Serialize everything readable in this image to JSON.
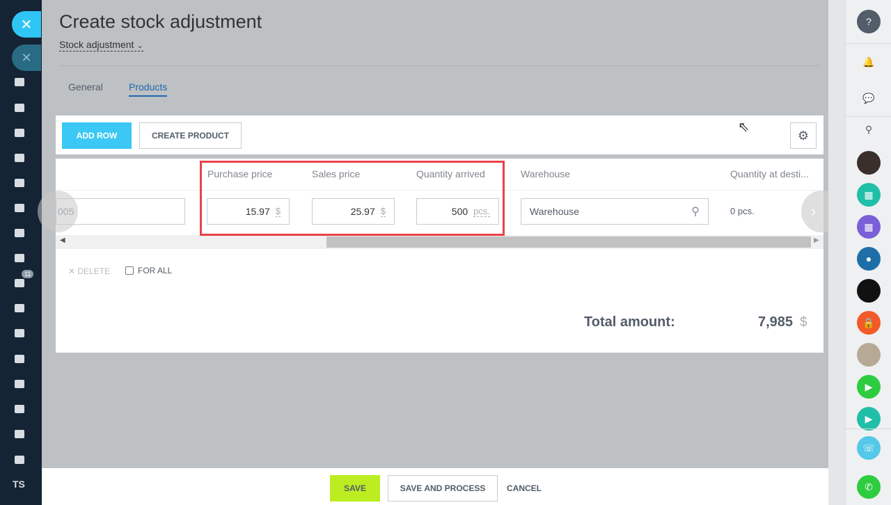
{
  "page": {
    "title": "Create stock adjustment",
    "subtitle": "Stock adjustment"
  },
  "tabs": [
    {
      "label": "General"
    },
    {
      "label": "Products"
    }
  ],
  "toolbar": {
    "add_row": "ADD ROW",
    "create_product": "CREATE PRODUCT",
    "settings_icon": "gear-icon"
  },
  "table": {
    "columns": [
      "Purchase price",
      "Sales price",
      "Quantity arrived",
      "Warehouse",
      "Quantity at desti..."
    ],
    "row": {
      "product_code": "005",
      "purchase_price": "15.97",
      "purchase_currency": "$",
      "sales_price": "25.97",
      "sales_currency": "$",
      "quantity": "500",
      "quantity_unit": "pcs.",
      "warehouse_placeholder": "Warehouse",
      "quantity_dest": "0 pcs."
    }
  },
  "actions": {
    "delete": "DELETE",
    "for_all": "FOR ALL"
  },
  "total": {
    "label": "Total amount:",
    "value": "7,985",
    "currency": "$"
  },
  "footer": {
    "save": "SAVE",
    "save_and_process": "SAVE AND PROCESS",
    "cancel": "CANCEL"
  },
  "left_sidebar": {
    "badge": "11",
    "user_initials": "TS"
  },
  "colors": {
    "accent": "#3bc8f5",
    "save": "#bbed21",
    "highlight": "#e8424a",
    "link": "#2067b0"
  }
}
